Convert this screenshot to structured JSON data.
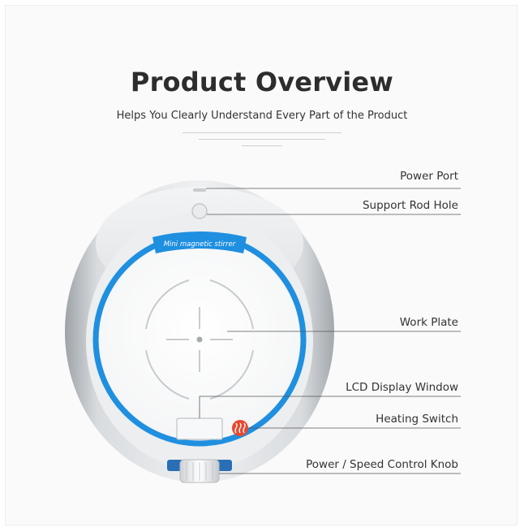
{
  "header": {
    "title": "Product Overview",
    "subtitle": "Helps You Clearly Understand Every Part of the Product"
  },
  "device": {
    "label": "Mini magnetic stirrer",
    "accent_color": "#1f8fe0",
    "heating_icon_color": "#e8482f",
    "heating_icon": "heat-waves-icon"
  },
  "callouts": [
    {
      "id": "power-port",
      "label": "Power Port"
    },
    {
      "id": "support-rod-hole",
      "label": "Support Rod Hole"
    },
    {
      "id": "work-plate",
      "label": "Work Plate"
    },
    {
      "id": "lcd-display-window",
      "label": "LCD Display Window"
    },
    {
      "id": "heating-switch",
      "label": "Heating Switch"
    },
    {
      "id": "power-speed-control-knob",
      "label": "Power / Speed Control Knob"
    }
  ]
}
